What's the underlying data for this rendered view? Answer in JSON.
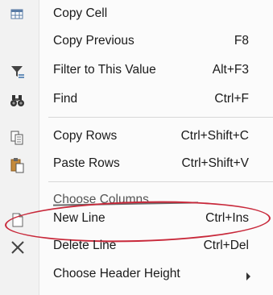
{
  "menu": {
    "items": [
      {
        "label": "Copy Cell",
        "shortcut": "",
        "icon": "copy-cell-icon"
      },
      {
        "label": "Copy Previous",
        "shortcut": "F8",
        "icon": ""
      },
      {
        "label": "Filter to This Value",
        "shortcut": "Alt+F3",
        "icon": "filter-icon"
      },
      {
        "label": "Find",
        "shortcut": "Ctrl+F",
        "icon": "binoculars-icon"
      },
      {
        "label": "Copy Rows",
        "shortcut": "Ctrl+Shift+C",
        "icon": "copy-rows-icon"
      },
      {
        "label": "Paste Rows",
        "shortcut": "Ctrl+Shift+V",
        "icon": "paste-icon"
      },
      {
        "label": "Choose Columns...",
        "shortcut": "",
        "icon": ""
      },
      {
        "label": "New Line",
        "shortcut": "Ctrl+Ins",
        "icon": "new-document-icon"
      },
      {
        "label": "Delete Line",
        "shortcut": "Ctrl+Del",
        "icon": "delete-x-icon"
      },
      {
        "label": "Choose Header Height",
        "shortcut": "",
        "icon": ""
      }
    ],
    "colors": {
      "highlight_ring": "#c8283a",
      "gutter": "#f2f2f2",
      "background": "#fbfbfb"
    }
  }
}
